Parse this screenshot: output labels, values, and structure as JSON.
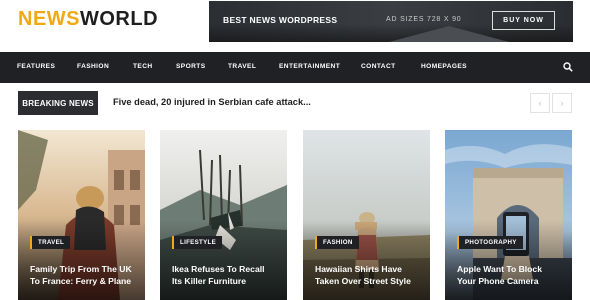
{
  "brand": {
    "part1": "NEWS",
    "part2": "WORLD"
  },
  "ad": {
    "title": "BEST NEWS WORDPRESS",
    "sizes": "AD SIZES 728 X 90",
    "button": "BUY NOW"
  },
  "nav": {
    "items": [
      "FEATURES",
      "FASHION",
      "TECH",
      "SPORTS",
      "TRAVEL",
      "ENTERTAINMENT",
      "CONTACT",
      "HOMEPAGES"
    ],
    "search_icon": "search-icon"
  },
  "breaking": {
    "label": "BREAKING NEWS",
    "headline": "Five dead, 20 injured in Serbian cafe attack..."
  },
  "cards": [
    {
      "tag": "TRAVEL",
      "title_line1": "Family Trip From The UK",
      "title_line2": "To France: Ferry & Plane"
    },
    {
      "tag": "LIFESTYLE",
      "title_line1": "Ikea Refuses To Recall",
      "title_line2": "Its Killer Furniture"
    },
    {
      "tag": "FASHION",
      "title_line1": "Hawaiian Shirts Have",
      "title_line2": "Taken Over Street Style"
    },
    {
      "tag": "PHOTOGRAPHY",
      "title_line1": "Apple Want To Block",
      "title_line2": "Your Phone Camera"
    }
  ],
  "colors": {
    "accent": "#f2a814",
    "dark": "#1f2124"
  }
}
